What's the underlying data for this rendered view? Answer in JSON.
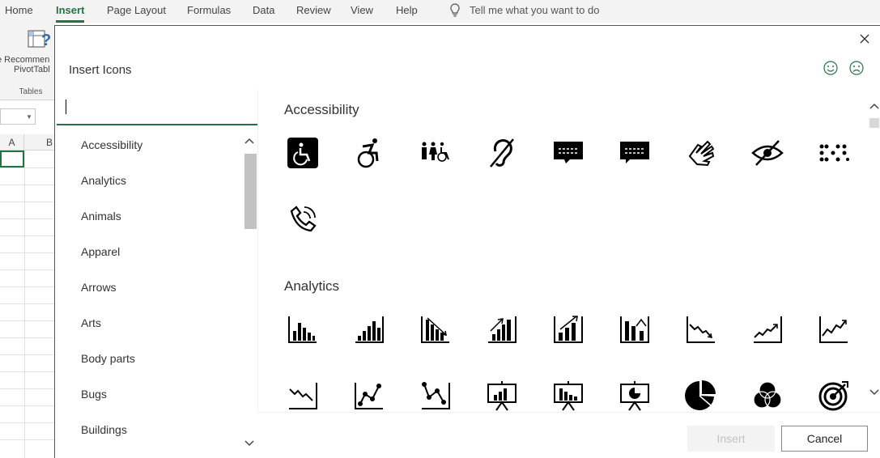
{
  "ribbon": {
    "tabs": [
      "Home",
      "Insert",
      "Page Layout",
      "Formulas",
      "Data",
      "Review",
      "View",
      "Help"
    ],
    "active_tab": "Insert",
    "tell_me": "Tell me what you want to do",
    "pivot_label_1": "e Recommen",
    "pivot_label_2": "PivotTabl",
    "group_label": "Tables"
  },
  "sheet": {
    "col_a": "A",
    "col_b": "B"
  },
  "dialog": {
    "title": "Insert Icons",
    "search_value": "",
    "categories": [
      "Accessibility",
      "Analytics",
      "Animals",
      "Apparel",
      "Arrows",
      "Arts",
      "Body parts",
      "Bugs",
      "Buildings"
    ],
    "sections": {
      "accessibility": {
        "title": "Accessibility",
        "icons": [
          "wheelchair-sign-icon",
          "active-wheelchair-icon",
          "family-accessibility-icon",
          "hearing-impaired-icon",
          "closed-captions-icon",
          "open-captions-icon",
          "sign-language-icon",
          "low-vision-icon",
          "braille-icon",
          "volume-phone-icon"
        ]
      },
      "analytics": {
        "title": "Analytics",
        "icons": [
          "bar-chart-icon",
          "bar-chart-up-icon",
          "bar-chart-down-trend-icon",
          "bar-chart-up-trend-icon",
          "bar-chart-rising-icon",
          "bar-chart-falling-icon",
          "line-trend-down-icon",
          "line-trend-up-icon",
          "line-trend-rising-icon",
          "line-zigzag-icon",
          "scatter-line-up-icon",
          "scatter-line-down-icon",
          "presentation-bar-icon",
          "presentation-column-icon",
          "presentation-pie-icon",
          "pie-chart-icon",
          "venn-diagram-icon",
          "target-icon"
        ]
      }
    },
    "insert_label": "Insert",
    "cancel_label": "Cancel"
  }
}
